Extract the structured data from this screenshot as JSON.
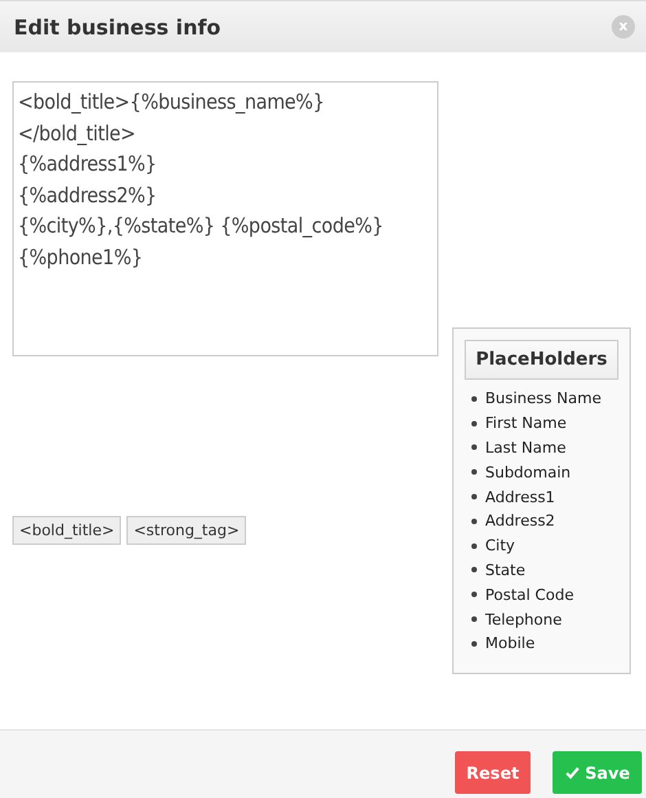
{
  "dialog": {
    "title": "Edit business info",
    "close_label": "x"
  },
  "template": {
    "value": "<bold_title>{%business_name%}\n</bold_title>\n{%address1%}\n{%address2%}\n{%city%},{%state%} {%postal_code%}\n{%phone1%}"
  },
  "tag_buttons": [
    "<bold_title>",
    "<strong_tag>"
  ],
  "placeholders": {
    "title": "PlaceHolders",
    "items": [
      "Business Name",
      "First Name",
      "Last Name",
      "Subdomain",
      "Address1",
      "Address2",
      "City",
      "State",
      "Postal Code",
      "Telephone",
      "Mobile"
    ]
  },
  "buttons": [
    {
      "kind": "reset",
      "label": "Reset"
    },
    {
      "kind": "save",
      "label": "Save"
    }
  ]
}
